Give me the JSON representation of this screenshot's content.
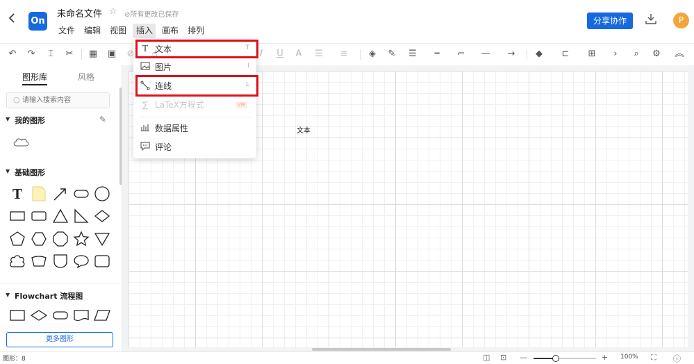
{
  "header": {
    "back_icon": "chevron-left-icon",
    "logo_text": "On",
    "file_name": "未命名文件",
    "save_status": "所有更改已保存",
    "share_label": "分享协作",
    "avatar_letter": "P",
    "brand_color": "#1769e0"
  },
  "menu": {
    "items": [
      "文件",
      "编辑",
      "视图",
      "插入",
      "画布",
      "排列"
    ],
    "active": "插入"
  },
  "insert_menu": {
    "items": [
      {
        "label": "文本",
        "shortcut": "T",
        "icon": "text-icon",
        "highlighted": true
      },
      {
        "label": "图片",
        "shortcut": "I",
        "icon": "image-icon"
      },
      {
        "label": "连线",
        "shortcut": "L",
        "icon": "connector-icon",
        "highlighted": true
      },
      {
        "label": "LaTeX方程式",
        "badge": "VIP",
        "icon": "formula-icon",
        "disabled": true
      },
      {
        "label": "数据属性",
        "icon": "bar-chart-icon"
      },
      {
        "label": "评论",
        "icon": "comment-icon"
      }
    ],
    "highlight_color": "#e0101b"
  },
  "left_panel": {
    "tabs": [
      "图形库",
      "风格"
    ],
    "search_placeholder": "请输入搜索内容",
    "sections": {
      "my_shapes": "我的图形",
      "basic_shapes": "基础图形",
      "flowchart": "Flowchart 流程图"
    },
    "more_shapes_label": "更多图形"
  },
  "canvas": {
    "text": "文本"
  },
  "status_bar": {
    "shape_count": "图形：8",
    "zoom_level": "100%",
    "zoom_fraction": 0.35
  }
}
